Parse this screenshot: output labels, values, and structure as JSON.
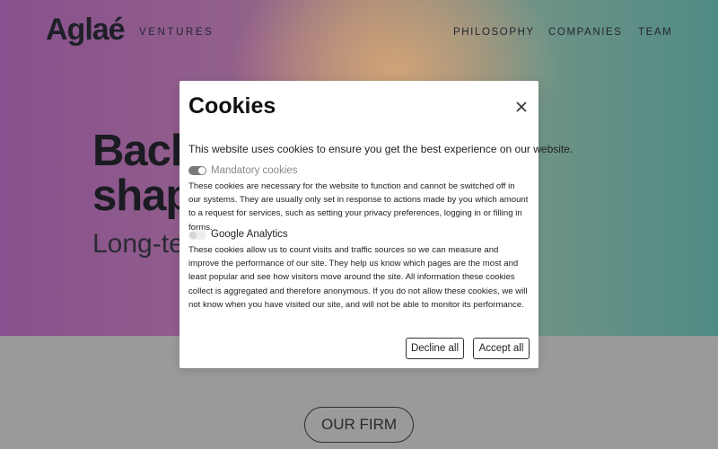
{
  "header": {
    "logo": "Aglaé",
    "logo_sub": "VENTURES",
    "nav": [
      "PHILOSOPHY",
      "COMPANIES",
      "TEAM"
    ]
  },
  "hero": {
    "headline_line1": "Back",
    "headline_line2": "shap",
    "subline": "Long-te"
  },
  "main": {
    "firm_button": "OUR FIRM"
  },
  "modal": {
    "title": "Cookies",
    "intro": "This website uses cookies to ensure you get the best experience on our website.",
    "sections": [
      {
        "label": "Mandatory cookies",
        "enabled": true,
        "description": "These cookies are necessary for the website to function and cannot be switched off in our systems. They are usually only set in response to actions made by you which amount to a request for services, such as setting your privacy preferences, logging in or filling in forms."
      },
      {
        "label": "Google Analytics",
        "enabled": false,
        "description": "These cookies allow us to count visits and traffic sources so we can measure and improve the performance of our site. They help us know which pages are the most and least popular and see how visitors move around the site. All information these cookies collect is aggregated and therefore anonymous. If you do not allow these cookies, we will not know when you have visited our site, and will not be able to monitor its performance."
      }
    ],
    "decline_label": "Decline all",
    "accept_label": "Accept all"
  },
  "colors": {
    "accent_purple": "#88508e",
    "accent_teal": "#4f8b84",
    "modal_bg": "#ffffff"
  }
}
